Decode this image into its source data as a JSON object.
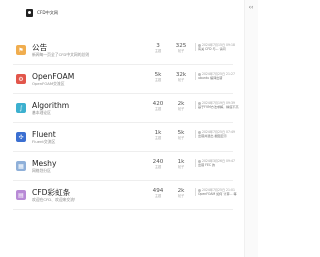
{
  "header": {
    "site_title": "CFD中文网",
    "sidebar_toggle_icon": "chevron-left-icon"
  },
  "stat_labels": {
    "topics": "主题",
    "posts": "帖子"
  },
  "categories": [
    {
      "name": "公告",
      "desc": "新闻每一页全了CFD中文网的总则",
      "icon": "bullhorn-icon",
      "icon_glyph": "⚑",
      "color": "#f0ad4e",
      "topics": "3",
      "posts": "325",
      "latest_time": "2024年7月15日 09:18",
      "latest_title": "有关 CFD 与... 请问"
    },
    {
      "name": "OpenFOAM",
      "desc": "OpenFOAM交流区",
      "icon": "gear-icon",
      "icon_glyph": "⚙",
      "color": "#e2564b",
      "topics": "5k",
      "posts": "32k",
      "latest_time": "2024年7月25日 21:27",
      "latest_title": "ubuntu 编译出错"
    },
    {
      "name": "Algorithm",
      "desc": "基本理论区",
      "icon": "function-icon",
      "icon_glyph": "∫",
      "color": "#3cb0cf",
      "topics": "420",
      "posts": "2k",
      "latest_time": "2024年7月19日 09:39",
      "latest_title": "基于FVM方法求解，精度不高"
    },
    {
      "name": "Fluent",
      "desc": "Fluent交流区",
      "icon": "fan-icon",
      "icon_glyph": "✣",
      "color": "#3b6fd1",
      "topics": "1k",
      "posts": "5k",
      "latest_time": "2024年7月25日 07:49",
      "latest_title": "出错并退出 截图显示"
    },
    {
      "name": "Meshy",
      "desc": "网格划分区",
      "icon": "grid-icon",
      "icon_glyph": "▦",
      "color": "#8fb0d9",
      "topics": "240",
      "posts": "1k",
      "latest_time": "2024年3月26日 09:47",
      "latest_title": "出错 FEC 的"
    },
    {
      "name": "CFD彩虹条",
      "desc": "欢迎在CFD、欢迎来交流！",
      "icon": "chart-icon",
      "icon_glyph": "▤",
      "color": "#b88ad6",
      "topics": "494",
      "posts": "2k",
      "latest_time": "2024年7月25日 21:01",
      "latest_title": "OpenFOAM 如何 计算... 等"
    }
  ]
}
